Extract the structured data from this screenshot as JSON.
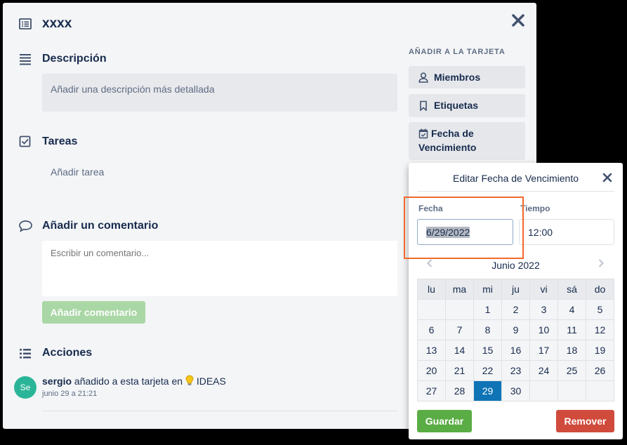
{
  "card": {
    "title": "xxxx",
    "close_icon": "close-icon",
    "description": {
      "title": "Descripción",
      "placeholder": "Añadir una descripción más detallada"
    },
    "tasks": {
      "title": "Tareas",
      "add_label": "Añadir tarea"
    },
    "comment": {
      "title": "Añadir un comentario",
      "placeholder": "Escribir un comentario...",
      "button_label": "Añadir comentario"
    },
    "actions": {
      "title": "Acciones",
      "items": [
        {
          "avatar_initials": "Se",
          "user": "sergio",
          "text": "añadido a esta tarjeta en",
          "list_icon": "lightbulb-icon",
          "list_name": "IDEAS",
          "date": "junio 29 a 21:21"
        }
      ]
    }
  },
  "sidebar": {
    "heading": "AÑADIR A LA TARJETA",
    "buttons": [
      {
        "icon": "user-icon",
        "label": "Miembros"
      },
      {
        "icon": "bookmark-icon",
        "label": "Etiquetas"
      },
      {
        "icon": "calendar-icon",
        "label_line1": "Fecha de",
        "label_line2": "Vencimiento"
      }
    ]
  },
  "due_date_popup": {
    "title": "Editar Fecha de Vencimiento",
    "date_label": "Fecha",
    "date_value": "6/29/2022",
    "time_label": "Tiempo",
    "time_value": "12:00",
    "month_label": "Junio 2022",
    "weekdays": [
      "lu",
      "ma",
      "mi",
      "ju",
      "vi",
      "sá",
      "do"
    ],
    "weeks": [
      [
        "",
        "",
        "1",
        "2",
        "3",
        "4",
        "5"
      ],
      [
        "6",
        "7",
        "8",
        "9",
        "10",
        "11",
        "12"
      ],
      [
        "13",
        "14",
        "15",
        "16",
        "17",
        "18",
        "19"
      ],
      [
        "20",
        "21",
        "22",
        "23",
        "24",
        "25",
        "26"
      ],
      [
        "27",
        "28",
        "29",
        "30",
        "",
        "",
        ""
      ]
    ],
    "selected_day": "29",
    "save_label": "Guardar",
    "remove_label": "Remover",
    "colors": {
      "save": "#5aac44",
      "remove": "#d04b3c",
      "selected": "#0e74b6",
      "highlight": "#f26a2c"
    }
  }
}
